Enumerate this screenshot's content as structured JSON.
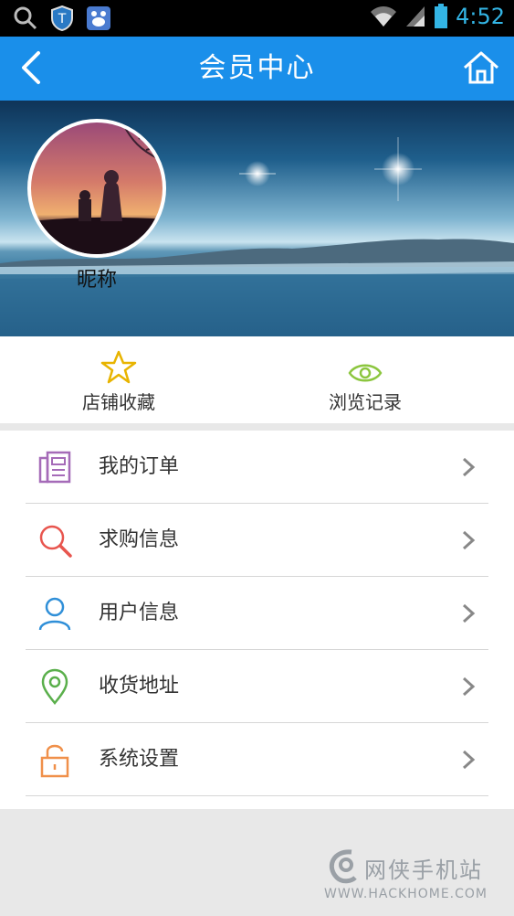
{
  "status_bar": {
    "time": "4:52",
    "left_icons": [
      "search-icon",
      "shield-icon",
      "baidu-icon"
    ],
    "right_icons": [
      "wifi-icon",
      "signal-icon",
      "battery-icon"
    ]
  },
  "header": {
    "title": "会员中心",
    "back_icon": "back-arrow-icon",
    "home_icon": "home-icon",
    "color": "#1a8fea"
  },
  "profile": {
    "nickname": "昵称"
  },
  "quick_actions": [
    {
      "label": "店铺收藏",
      "icon": "star-icon",
      "color": "#e8b400"
    },
    {
      "label": "浏览记录",
      "icon": "eye-icon",
      "color": "#8cc63f"
    }
  ],
  "menu": [
    {
      "label": "我的订单",
      "icon": "order-icon",
      "color": "#a56bb8"
    },
    {
      "label": "求购信息",
      "icon": "search-icon",
      "color": "#e8554e"
    },
    {
      "label": "用户信息",
      "icon": "user-icon",
      "color": "#2f8fd8"
    },
    {
      "label": "收货地址",
      "icon": "location-icon",
      "color": "#5aaf4b"
    },
    {
      "label": "系统设置",
      "icon": "unlock-icon",
      "color": "#f0904a"
    }
  ],
  "watermark": {
    "name": "网侠手机站",
    "url": "WWW.HACKHOME.COM"
  }
}
